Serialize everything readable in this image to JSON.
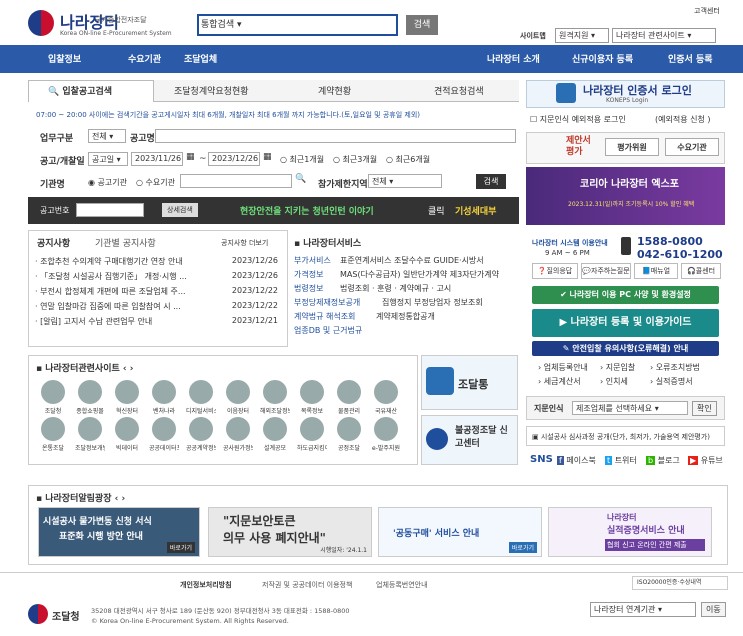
{
  "header": {
    "logo_title": "나라장터",
    "logo_sub": "국가종합전자조달",
    "logo_en": "Korea ON-line E-Procurement System",
    "search_scope": "통합검색",
    "search_button": "검색",
    "top_link": "고객센터",
    "sitemap": "사이트맵",
    "remote_support": "원격지원",
    "related_sites": "나라장터 관련사이트"
  },
  "nav": {
    "items": [
      "입찰정보",
      "수요기관",
      "조달업체"
    ],
    "right_items": [
      "나라장터 소개",
      "신규이용자 등록",
      "인증서 등록"
    ]
  },
  "tabs": [
    "입찰공고검색",
    "조달청계약요청현황",
    "계약현황",
    "견적요청검색"
  ],
  "search_form": {
    "notice": "07:00 ~ 20:00 사이에는 검색기간을 공고게시일자 최대 6개월, 개찰일자 최대 6개월 까지 가능합니다.(토,일요일 및 공휴일 제외)",
    "task_label": "업무구분",
    "task_value": "전체",
    "title_label": "공고명",
    "period_label": "공고/개찰일",
    "period_type": "공고일",
    "date_from": "2023/11/26",
    "date_to": "2023/12/26",
    "ranges": [
      "최근1개월",
      "최근3개월",
      "최근6개월"
    ],
    "org_label": "기관명",
    "org_options": [
      "공고기관",
      "수요기관"
    ],
    "region_label": "참가제한지역",
    "region_value": "전체",
    "search_button": "검색",
    "no_label": "공고번호",
    "detail_button": "상세검색",
    "banner_green": "현장안전을 지키는 청년인턴 이야기",
    "banner_click": "클릭",
    "banner_yellow": "기성세대부"
  },
  "notice_tabs": [
    "공지사항",
    "기관별 공지사항"
  ],
  "notice_more": "공지사항 더보기",
  "notices": [
    {
      "title": "· 조합추천 수의계약 구매대행기간 연장 안내",
      "date": "2023/12/26"
    },
    {
      "title": "· 「조달청 시설공사 집행기준」 개정·시행 ...",
      "date": "2023/12/26"
    },
    {
      "title": "· 부전시 합정체계 개편에 따른 조달업체 주...",
      "date": "2023/12/22"
    },
    {
      "title": "· 연말 입찰마감 집중에 따른 입찰참여 시 ...",
      "date": "2023/12/22"
    },
    {
      "title": "· [알림] 고지서 수납 관련업무 안내",
      "date": "2023/12/21"
    }
  ],
  "service": {
    "title": "나라장터서비스",
    "rows": [
      {
        "k": "부가서비스",
        "v": "표준연계서비스 조달수수료 GUIDE·시방서"
      },
      {
        "k": "가격정보",
        "v": "MAS(다수공급자) 일반단가계약 제3자단가계약"
      },
      {
        "k": "법령정보",
        "v": "법령조회 · 훈령 · 계약예규 · 고시"
      },
      {
        "k": "부정당제재정보공개",
        "v": "집행정지 부정당업자 정보조회"
      },
      {
        "k": "계약법규 해석조회",
        "v": "계약제정통합공개"
      },
      {
        "k": "업종DB 및 근거법규",
        "v": ""
      }
    ]
  },
  "related_sites": {
    "title": "나라장터관련사이트",
    "row1": [
      "조달청",
      "종합쇼핑몰",
      "혁신장터",
      "벤처나라",
      "디지털서비스몰",
      "이음장터",
      "해외조달정보",
      "목록정보",
      "물품관리",
      "국유재산"
    ],
    "row2": [
      "온통조달",
      "조달정보개방",
      "빅데이터",
      "공공데이터포털",
      "공공계약정보공개",
      "공사원가정보시스템",
      "설계공모",
      "하도급지킴이",
      "공정조달",
      "e-발주지원"
    ]
  },
  "side_promos": [
    "조달통",
    "불공정조달 신고센터"
  ],
  "alert_plaza": {
    "title": "나라장터알림광장",
    "banners": [
      {
        "l1": "시설공사 물가변동 신청 서식",
        "l2": "표준화 시행 방안 안내",
        "more": "바로가기"
      },
      {
        "l1": "\"지문보안토큰",
        "l2": "의무 사용 폐지안내\"",
        "date": "시행일자: '24.1.1"
      },
      {
        "l1": "'공동구매' 서비스 안내",
        "l2": "",
        "more": "바로가기"
      },
      {
        "l1": "나라장터",
        "l2": "실적증명서비스 안내",
        "l3": "협회 신고 온라인 간편 제출"
      }
    ]
  },
  "right": {
    "cert_login": "나라장터 인증서 로그인",
    "cert_sub": "KONEPS Login",
    "fingerprint": "지문인식 예외적용 로그인",
    "fingerprint_link": "(예외적용 신청 )",
    "proposal": "제안서 평가",
    "eval_member": "평가위원",
    "demand_org": "수요기관",
    "expo_title": "코리아 나라장터 엑스포",
    "expo_sub": "2023.12.31(일)까지 조기등록시 10% 할인 혜택",
    "helpdesk_label": "나라장터 시스템 이용안내",
    "helpdesk_hours": "9 AM ~ 6 PM",
    "phone1": "1588-0800",
    "phone2": "042-610-1200",
    "quick": [
      "질의응답",
      "자주하는질문",
      "매뉴얼",
      "콜센터"
    ],
    "check_env": "나라장터 이용 PC 사양 및 환경설정",
    "register_guide": "나라장터 등록 및 이용가이드",
    "safety": "안전입찰 유의사항(오류해결) 안내",
    "links": [
      "업체등록안내",
      "지문입찰",
      "오류조치방법",
      "세금계산서",
      "인치세",
      "실적증명서"
    ],
    "branch_label": "지문인식",
    "branch_select": "제조업체를 선택하세요",
    "branch_btn": "확인",
    "price_notice": "시설공사 심사과정 공개(단가, 최저가, 가술용역 제안평가)",
    "sns": "SNS",
    "sns_items": [
      "페이스북",
      "트위터",
      "블로그",
      "유튜브"
    ]
  },
  "footer": {
    "links": [
      "개인정보처리방침",
      "저작권 및 공공데이터 이용정책",
      "업체등록번연안내"
    ],
    "iso": "ISO20000인증·수상내역",
    "org": "조달청",
    "address": "35208 대전광역시 서구 청사로 189 (둔산동 920) 정부대전청사 3동 대표전화 : 1588-0800",
    "copyright": "© Korea On-line E-Procurement System. All Rights Reserved.",
    "select": "나라장터 연계기관",
    "go": "이동"
  },
  "colors": {
    "nav": "#2b5ba8",
    "dark": "#333333",
    "green": "#2f8f4f",
    "teal": "#1a8a8a",
    "navy": "#1f3c88"
  }
}
